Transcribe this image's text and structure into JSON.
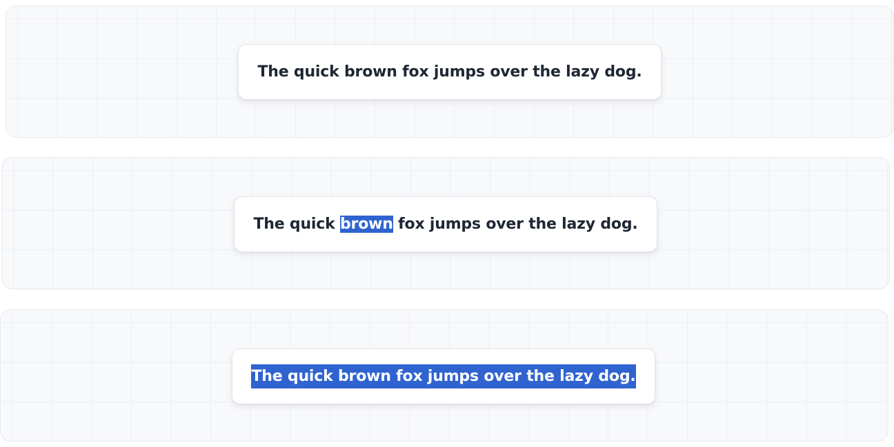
{
  "samples": [
    {
      "id": "no-selection",
      "text": "The quick brown fox jumps over the lazy dog."
    },
    {
      "id": "word-selection",
      "before": "The quick ",
      "selected": "brown",
      "after": " fox jumps over the lazy dog."
    },
    {
      "id": "full-selection",
      "selected": "The quick brown fox jumps over the lazy dog."
    }
  ],
  "colors": {
    "selection_background": "#2f63cf",
    "selection_text": "#ffffff",
    "text": "#1f2633",
    "panel_background": "#f8f9fb",
    "card_background": "#ffffff"
  }
}
